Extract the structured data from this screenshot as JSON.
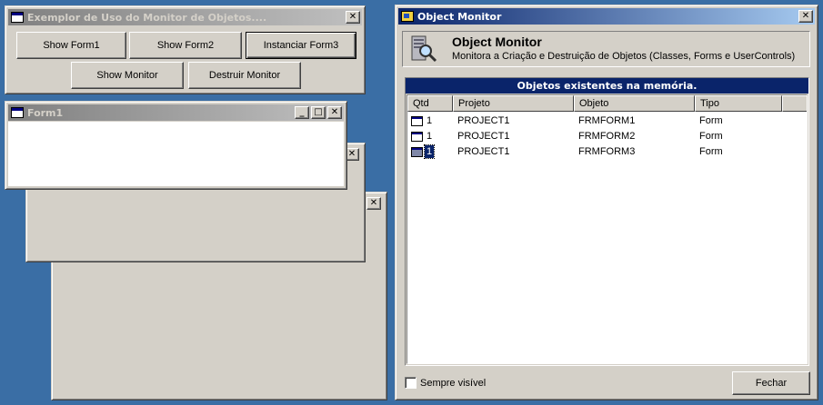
{
  "example_window": {
    "title": "Exemplor de Uso do Monitor de Objetos....",
    "buttons": {
      "show_form1": "Show Form1",
      "show_form2": "Show Form2",
      "instanciar_form3": "Instanciar Form3",
      "show_monitor": "Show Monitor",
      "destruir_monitor": "Destruir Monitor"
    },
    "close": "✕"
  },
  "form1": {
    "title": "Form1",
    "minimize": "_",
    "maximize": "□",
    "close": "✕"
  },
  "form2": {
    "close": "✕"
  },
  "form3": {
    "close": "✕"
  },
  "monitor": {
    "title": "Object Monitor",
    "close": "✕",
    "header_title": "Object Monitor",
    "header_subtitle": "Monitora a Criação e Destruição de Objetos (Classes, Forms e UserControls)",
    "list_caption": "Objetos existentes na memória.",
    "columns": [
      "Qtd",
      "Projeto",
      "Objeto",
      "Tipo"
    ],
    "rows": [
      {
        "qtd": "1",
        "projeto": "PROJECT1",
        "objeto": "FRMFORM1",
        "tipo": "Form",
        "icon": "form-icon",
        "selected": false
      },
      {
        "qtd": "1",
        "projeto": "PROJECT1",
        "objeto": "FRMFORM2",
        "tipo": "Form",
        "icon": "form-icon",
        "selected": false
      },
      {
        "qtd": "1",
        "projeto": "PROJECT1",
        "objeto": "FRMFORM3",
        "tipo": "Form",
        "icon": "form-icon",
        "selected": true
      }
    ],
    "checkbox_label": "Sempre visível",
    "checkbox_checked": false,
    "fechar": "Fechar"
  },
  "colors": {
    "desktop": "#3a6ea5",
    "active_title": "#0a246a",
    "caption_bar": "#0a246a",
    "window_face": "#d4d0c8"
  }
}
